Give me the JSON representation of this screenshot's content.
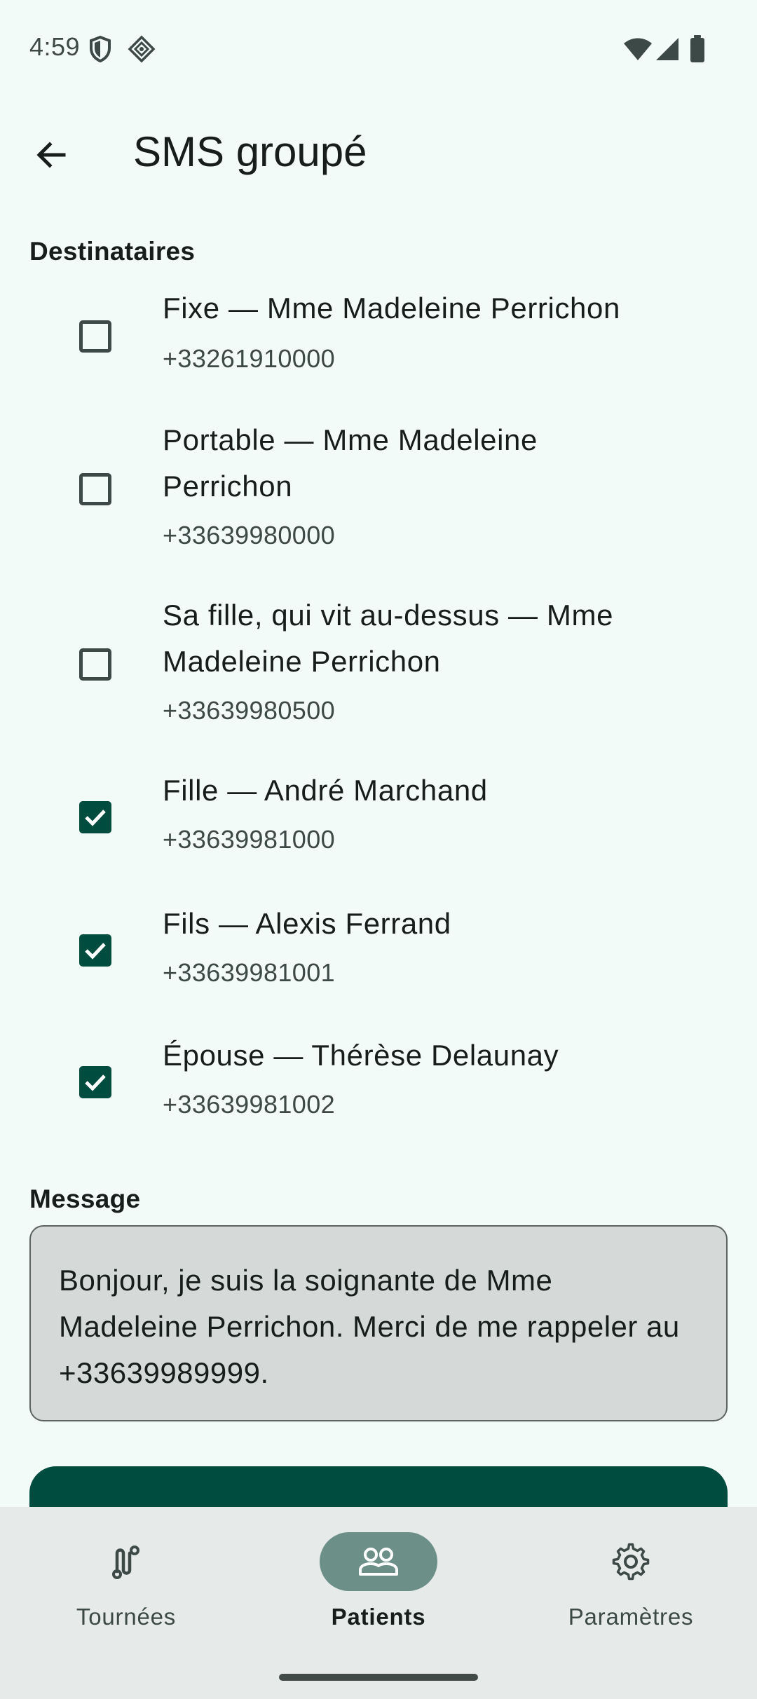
{
  "status_bar": {
    "time": "4:59",
    "icons_left": [
      "shield-icon",
      "vpn-key-icon"
    ],
    "icons_right": [
      "wifi-icon",
      "cellular-signal-icon",
      "battery-icon"
    ]
  },
  "app_bar": {
    "back_icon": "arrow-left-icon",
    "title": "SMS groupé"
  },
  "recipients_section": {
    "label": "Destinataires",
    "items": [
      {
        "name": "Fixe — Mme Madeleine Perrichon",
        "phone": "+33261910000",
        "checked": false
      },
      {
        "name": "Portable — Mme Madeleine Perrichon",
        "phone": "+33639980000",
        "checked": false
      },
      {
        "name": "Sa fille, qui vit au-dessus — Mme Madeleine Perrichon",
        "phone": "+33639980500",
        "checked": false
      },
      {
        "name": "Fille — André Marchand",
        "phone": "+33639981000",
        "checked": true
      },
      {
        "name": "Fils — Alexis Ferrand",
        "phone": "+33639981001",
        "checked": true
      },
      {
        "name": "Épouse — Thérèse Delaunay",
        "phone": "+33639981002",
        "checked": true
      }
    ]
  },
  "message_section": {
    "label": "Message",
    "value": "Bonjour, je suis la soignante de Mme Madeleine Perrichon. Merci de me rappeler au +33639989999."
  },
  "bottom_nav": {
    "items": [
      {
        "label": "Tournées",
        "icon": "route-icon",
        "active": false
      },
      {
        "label": "Patients",
        "icon": "people-icon",
        "active": true
      },
      {
        "label": "Paramètres",
        "icon": "gear-icon",
        "active": false
      }
    ]
  },
  "colors": {
    "background": "#f3fbf8",
    "accent": "#004d40",
    "nav_background": "#e6ebe9",
    "nav_active_pill": "#6c8f88",
    "message_background": "#d5d9d8"
  }
}
